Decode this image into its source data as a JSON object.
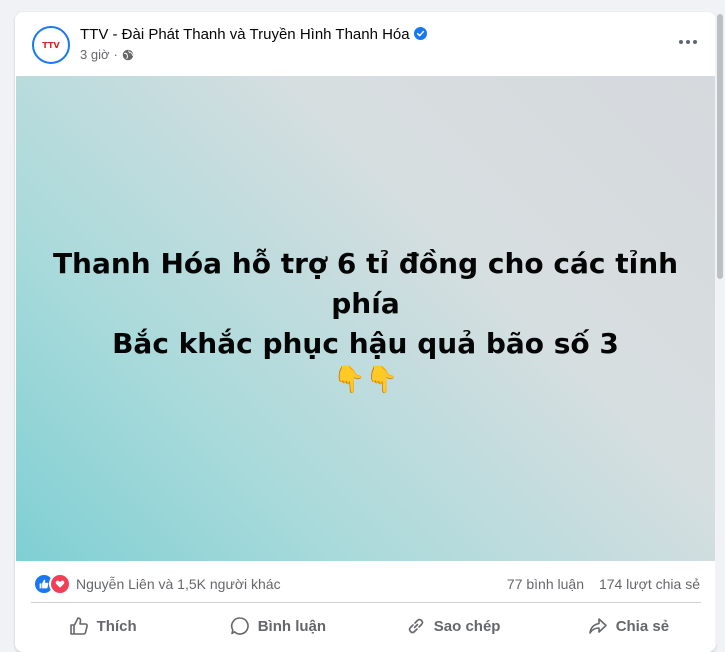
{
  "post": {
    "page_name": "TTV - Đài Phát Thanh và Truyền Hình Thanh Hóa",
    "avatar_text": "TTV",
    "time": "3 giờ",
    "privacy_icon": "globe-icon",
    "more_icon": "more-horizontal-icon",
    "text_line1": "Thanh Hóa hỗ trợ 6 tỉ đồng cho các tỉnh phía",
    "text_line2": "Bắc khắc phục hậu quả bão số 3",
    "emoji": "👇👇"
  },
  "stats": {
    "reaction_icons": [
      "like-reaction-icon",
      "love-reaction-icon"
    ],
    "reactions_text": "Nguyễn Liên và 1,5K người khác",
    "comments": "77 bình luận",
    "shares": "174 lượt chia sẻ"
  },
  "actions": [
    {
      "label": "Thích",
      "icon": "thumbs-up-icon"
    },
    {
      "label": "Bình luận",
      "icon": "comment-icon"
    },
    {
      "label": "Sao chép",
      "icon": "link-icon"
    },
    {
      "label": "Chia sẻ",
      "icon": "share-icon"
    }
  ],
  "colors": {
    "accent": "#1877f2",
    "love": "#f33e58",
    "secondary_text": "#65676b"
  }
}
